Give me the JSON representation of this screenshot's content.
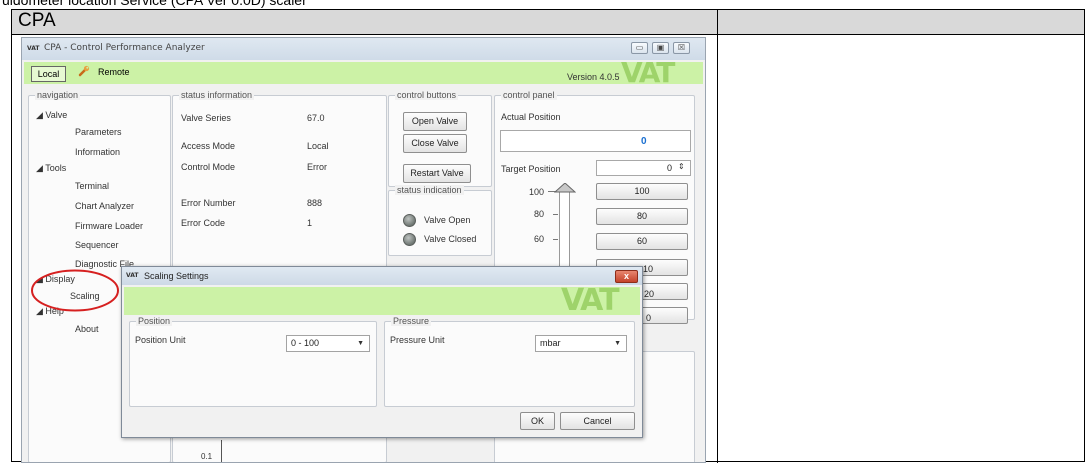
{
  "document": {
    "top_text": "uidometer location Service (CPA Ver 0.0D) scaler",
    "title": "CPA"
  },
  "app": {
    "window_title": "CPA - Control Performance Analyzer",
    "logo_small": "VAT",
    "local_label": "Local",
    "remote_label": "Remote",
    "version": "Version 4.0.5",
    "logo": "VAT",
    "window_buttons": [
      "▭",
      "▣",
      "☒"
    ]
  },
  "navigation": {
    "title": "navigation",
    "groups": [
      {
        "label": "Valve",
        "items": [
          "Parameters",
          "Information"
        ]
      },
      {
        "label": "Tools",
        "items": [
          "Terminal",
          "Chart Analyzer",
          "Firmware Loader",
          "Sequencer",
          "Diagnostic File"
        ]
      },
      {
        "label": "Display",
        "items": [
          "Scaling"
        ]
      },
      {
        "label": "Help",
        "items": [
          "About"
        ]
      }
    ]
  },
  "status_information": {
    "title": "status information",
    "rows": [
      {
        "label": "Valve Series",
        "value": "67.0"
      },
      {
        "label": "Access Mode",
        "value": "Local"
      },
      {
        "label": "Control Mode",
        "value": "Error"
      },
      {
        "label": "Error Number",
        "value": "888"
      },
      {
        "label": "Error Code",
        "value": "1"
      }
    ]
  },
  "control_buttons": {
    "title": "control buttons",
    "open": "Open Valve",
    "close": "Close Valve",
    "restart": "Restart Valve"
  },
  "status_indication": {
    "title": "status indication",
    "open": "Valve Open",
    "closed": "Valve Closed"
  },
  "control_panel": {
    "title": "control panel",
    "actual_label": "Actual Position",
    "actual_value": "0",
    "target_label": "Target Position",
    "target_value": "0",
    "slider_ticks": [
      "100",
      "80",
      "60"
    ],
    "preset_buttons": [
      "100",
      "80",
      "60",
      "40",
      "20",
      "0"
    ],
    "preset_visible_suffixes": [
      "10",
      "20",
      "0"
    ]
  },
  "chart_fragment": {
    "tick": "0.1"
  },
  "dialog": {
    "title": "Scaling Settings",
    "logo": "VAT",
    "close": "x",
    "position_group": "Position",
    "position_unit_label": "Position Unit",
    "position_unit_value": "0 - 100",
    "pressure_group": "Pressure",
    "pressure_unit_label": "Pressure Unit",
    "pressure_unit_value": "mbar",
    "ok": "OK",
    "cancel": "Cancel"
  },
  "colors": {
    "accent_green": "#ccf2a6",
    "logo_green": "#9ed36a",
    "annotation_red": "#d62020",
    "link_blue": "#1a6fd0"
  }
}
